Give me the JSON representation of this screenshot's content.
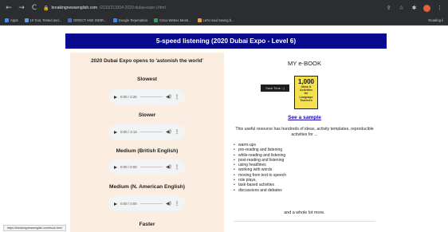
{
  "browser": {
    "url_domain": "breakingnewsenglish.com",
    "url_path": "/2110/211004-2020-dubai-expo-l.html",
    "bookmarks": [
      {
        "label": "Apps",
        "color": "#4a8af4"
      },
      {
        "label": "10 Tool, Tested and...",
        "color": "#5a9cf8"
      },
      {
        "label": "DIRECT AND INDIR...",
        "color": "#3d6fd6"
      },
      {
        "label": "Google Terjemahan",
        "color": "#4285f4"
      },
      {
        "label": "Cisco Webex Meeti...",
        "color": "#26a65b"
      },
      {
        "label": "Let's read Saving b...",
        "color": "#e8a33a"
      }
    ],
    "reading_list": "Reading li"
  },
  "page": {
    "banner": "5-speed listening (2020 Dubai Expo - Level 6)",
    "left": {
      "title": "2020 Dubai Expo opens to 'astonish the world'",
      "speeds": [
        {
          "label": "Slowest",
          "time": "0:00 / 2:25"
        },
        {
          "label": "Slower",
          "time": "0:00 / 2:13"
        },
        {
          "label": "Medium (British English)",
          "time": "0:00 / 0:00"
        },
        {
          "label": "Medium (N. American English)",
          "time": "0:00 / 0:00"
        },
        {
          "label": "Faster",
          "time": ""
        }
      ]
    },
    "right": {
      "title": "MY e-BOOK",
      "save_button": "Save Time :-)",
      "ebook_cover": {
        "big": "1,000",
        "lines": [
          "Ideas &",
          "Activities",
          "for",
          "Language",
          "Teachers"
        ]
      },
      "see_sample": "See a sample",
      "description": "This useful resource has hundreds of ideas, activity templates, reproducible activities for ...",
      "bullets": [
        "warm-ups",
        "pre-reading and listening",
        "while-reading and listening",
        "post-reading and listening",
        "using headlines",
        "working with words",
        "moving from text to speech",
        "role plays,",
        "task-based activities",
        "discussions and debates"
      ],
      "more": "and a whole lot more."
    }
  },
  "status_bar": "https://breakingnewsenglish.com/book.html"
}
